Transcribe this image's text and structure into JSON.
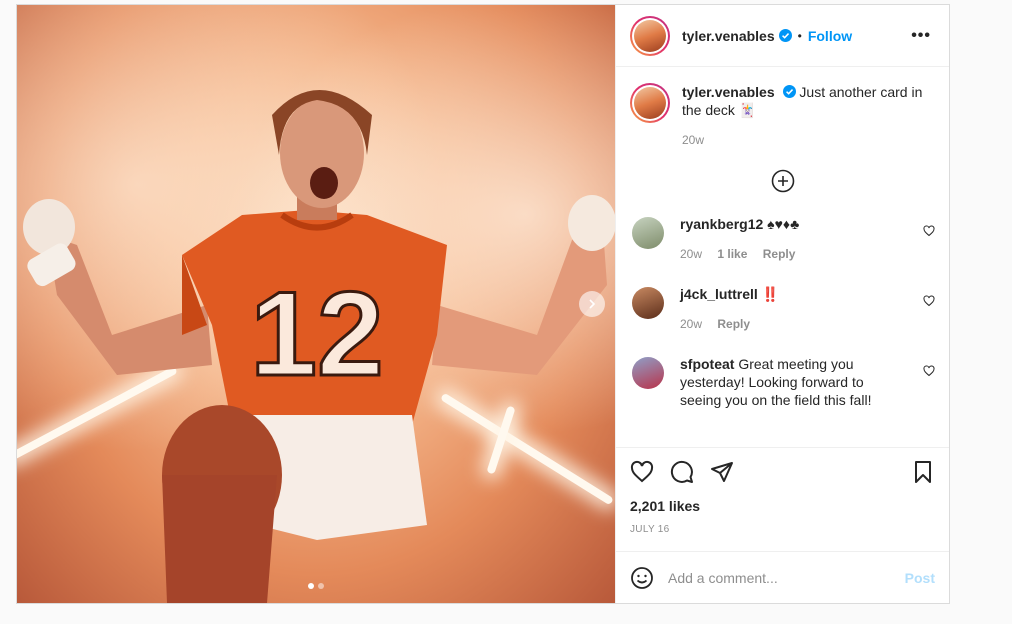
{
  "post": {
    "author": "tyler.venables",
    "follow_label": "Follow",
    "more_label": "•••",
    "caption": "Just another card in the deck 🃏",
    "caption_time": "20w",
    "likes": "2,201 likes",
    "date": "JULY 16",
    "media": {
      "current_slide": 1,
      "total_slides": 2
    }
  },
  "comments": [
    {
      "user": "ryankberg12",
      "text": "♠♥♦♣",
      "time": "20w",
      "likes": "1 like",
      "reply": "Reply"
    },
    {
      "user": "j4ck_luttrell",
      "text": "‼️",
      "time": "20w",
      "likes": "",
      "reply": "Reply"
    },
    {
      "user": "sfpoteat",
      "text": "Great meeting you yesterday! Looking forward to seeing you on the field this fall!",
      "time": "",
      "likes": "",
      "reply": ""
    }
  ],
  "add_comment": {
    "placeholder": "Add a comment...",
    "post_label": "Post"
  },
  "colors": {
    "accent": "#0095f6",
    "jersey": "#e8561f",
    "post_disabled": "#b2dffc"
  },
  "icons": [
    "verified-badge-icon",
    "more-options-icon",
    "load-more-plus-icon",
    "heart-icon",
    "comment-icon",
    "share-icon",
    "bookmark-icon",
    "emoji-icon",
    "chevron-right-icon"
  ]
}
